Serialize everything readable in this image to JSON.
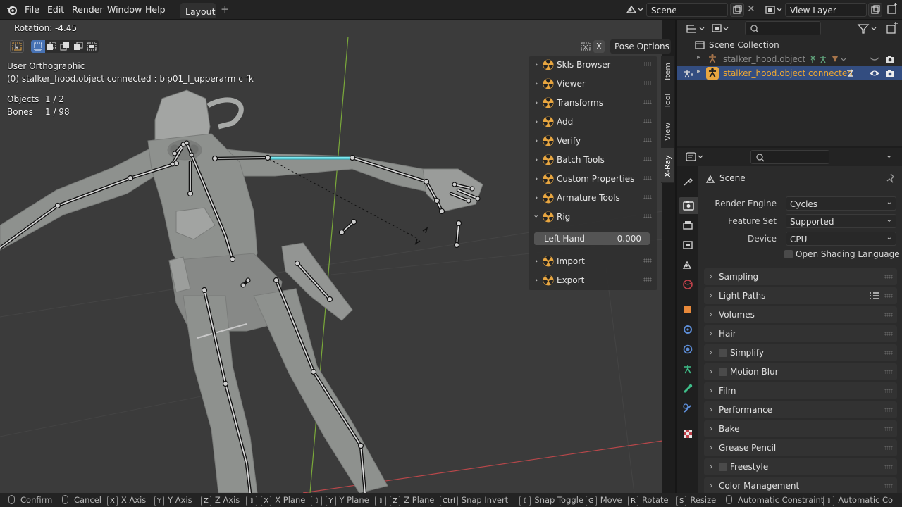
{
  "topbar": {
    "menus": [
      "File",
      "Edit",
      "Render",
      "Window",
      "Help"
    ],
    "workspace_tab": "Layout",
    "add_tab": "+",
    "scene": "Scene",
    "view_layer": "View Layer"
  },
  "viewport": {
    "operator_info": "Rotation: -4.45",
    "pose_options": "Pose Options",
    "x_label": "X",
    "view_name": "User Orthographic",
    "active_info": "(0) stalker_hood.object connected : bip01_l_upperarm c fk",
    "stats": {
      "objects_label": "Objects",
      "objects_value": "1 / 2",
      "bones_label": "Bones",
      "bones_value": "1 / 98"
    }
  },
  "npanel": {
    "items": [
      "Skls Browser",
      "Viewer",
      "Transforms",
      "Add",
      "Verify",
      "Batch Tools",
      "Custom Properties",
      "Armature Tools",
      "Rig",
      "Import",
      "Export"
    ],
    "left_hand_label": "Left Hand",
    "left_hand_value": "0.000",
    "tabs": [
      "Item",
      "Tool",
      "View",
      "X-Ray"
    ]
  },
  "outliner": {
    "collection": "Scene Collection",
    "rows": [
      "stalker_hood.object",
      "stalker_hood.object connected"
    ]
  },
  "properties": {
    "title": "Scene",
    "render_engine_label": "Render Engine",
    "render_engine": "Cycles",
    "feature_set_label": "Feature Set",
    "feature_set": "Supported",
    "device_label": "Device",
    "device": "CPU",
    "osl_label": "Open Shading Language",
    "panels": [
      "Sampling",
      "Light Paths",
      "Volumes",
      "Hair",
      "Simplify",
      "Motion Blur",
      "Film",
      "Performance",
      "Bake",
      "Grease Pencil",
      "Freestyle",
      "Color Management"
    ]
  },
  "statusbar": {
    "confirm": "Confirm",
    "cancel": "Cancel",
    "x_axis": "X Axis",
    "y_axis": "Y Axis",
    "z_axis": "Z Axis",
    "x_plane": "X Plane",
    "y_plane": "Y Plane",
    "z_plane": "Z Plane",
    "snap_invert": "Snap Invert",
    "snap_toggle": "Snap Toggle",
    "move": "Move",
    "rotate": "Rotate",
    "resize": "Resize",
    "auto_constraint": "Automatic Constraint",
    "auto_constraint_plane": "Automatic Co",
    "key_x": "X",
    "key_y": "Y",
    "key_z": "Z",
    "key_shift": "⇧",
    "key_ctrl": "Ctrl",
    "key_g": "G",
    "key_r": "R",
    "key_s": "S"
  },
  "colors": {
    "accent_orange": "#e8a640",
    "active_text": "#f0a830",
    "selected_bone": "#7fe8f0",
    "axis_green": "#7aa93a",
    "axis_red": "#b8474a"
  }
}
